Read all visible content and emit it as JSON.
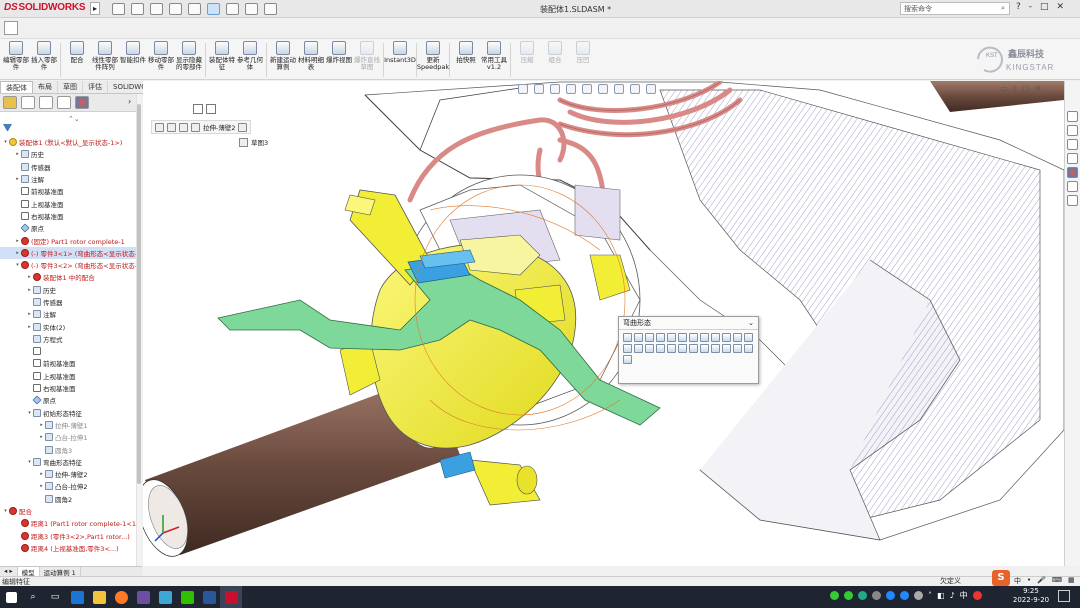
{
  "app": {
    "name": "SOLIDWORKS",
    "document_title": "装配体1.SLDASM *"
  },
  "titlebar": {
    "search_placeholder": "搜索命令",
    "controls": [
      "?",
      "-",
      "□",
      "✕"
    ]
  },
  "ribbon": {
    "buttons": [
      {
        "label": "编辑零部件",
        "icon": "edit-component-icon"
      },
      {
        "label": "插入零部件",
        "icon": "insert-component-icon"
      },
      {
        "label": "配合",
        "icon": "mate-icon"
      },
      {
        "label": "线性零部件阵列",
        "icon": "linear-pattern-icon"
      },
      {
        "label": "智能扣件",
        "icon": "smart-fasteners-icon"
      },
      {
        "label": "移动零部件",
        "icon": "move-component-icon"
      },
      {
        "label": "显示隐藏的零部件",
        "icon": "show-hidden-icon"
      },
      {
        "label": "装配体特征",
        "icon": "assembly-features-icon"
      },
      {
        "label": "参考几何体",
        "icon": "reference-geometry-icon"
      },
      {
        "label": "新建运动算例",
        "icon": "motion-study-icon"
      },
      {
        "label": "材料明细表",
        "icon": "bom-icon"
      },
      {
        "label": "爆炸视图",
        "icon": "exploded-view-icon"
      },
      {
        "label": "爆炸直线草图",
        "icon": "explode-line-icon",
        "disabled": true
      },
      {
        "label": "Instant3D",
        "icon": "instant3d-icon"
      },
      {
        "label": "更新Speedpak",
        "icon": "speedpak-icon"
      },
      {
        "label": "拍快照",
        "icon": "snapshot-icon"
      },
      {
        "label": "常用工具v1.2",
        "icon": "tools-icon"
      },
      {
        "label": "压缩",
        "icon": "suppress-icon",
        "disabled": true
      },
      {
        "label": "组合",
        "icon": "combine-icon",
        "disabled": true
      },
      {
        "label": "压凹",
        "icon": "indent-icon",
        "disabled": true
      }
    ],
    "brand": {
      "kst": "KST",
      "name_cn": "鑫辰科技",
      "name_en": "KINGSTAR"
    }
  },
  "command_tabs": [
    "装配体",
    "布局",
    "草图",
    "评估",
    "SOLIDWORKS 插件"
  ],
  "feature_tree": {
    "rows": [
      {
        "text": "装配体1 (默认<默认_显示状态-1>)",
        "level": 0,
        "icon": "assembly",
        "style": "red",
        "expand": "▾"
      },
      {
        "text": "历史",
        "level": 1,
        "icon": "folder",
        "expand": "▸"
      },
      {
        "text": "传感器",
        "level": 1,
        "icon": "folder",
        "expand": ""
      },
      {
        "text": "注解",
        "level": 1,
        "icon": "folder",
        "expand": "▸"
      },
      {
        "text": "前视基准面",
        "level": 1,
        "icon": "plane",
        "expand": ""
      },
      {
        "text": "上视基准面",
        "level": 1,
        "icon": "plane",
        "expand": ""
      },
      {
        "text": "右视基准面",
        "level": 1,
        "icon": "plane",
        "expand": ""
      },
      {
        "text": "原点",
        "level": 1,
        "icon": "point",
        "expand": ""
      },
      {
        "text": "(固定) Part1 rotor complete-1",
        "level": 1,
        "icon": "warning",
        "style": "red",
        "expand": "▸"
      },
      {
        "text": "(-) 零件3<1> (弯曲形态<显示状态-1>)",
        "level": 1,
        "icon": "warning",
        "style": "red",
        "expand": "▸",
        "highlight": true
      },
      {
        "text": "(-) 零件3<2> (弯曲形态<显示状态-1>)",
        "level": 1,
        "icon": "warning",
        "style": "red",
        "expand": "▾"
      },
      {
        "text": "装配体1 中的配合",
        "level": 2,
        "icon": "warning",
        "style": "red",
        "expand": "▸"
      },
      {
        "text": "历史",
        "level": 2,
        "icon": "folder",
        "expand": "▸"
      },
      {
        "text": "传感器",
        "level": 2,
        "icon": "folder",
        "expand": ""
      },
      {
        "text": "注解",
        "level": 2,
        "icon": "folder",
        "expand": "▸"
      },
      {
        "text": "实体(2)",
        "level": 2,
        "icon": "folder",
        "expand": "▸"
      },
      {
        "text": "方程式",
        "level": 2,
        "icon": "folder",
        "expand": ""
      },
      {
        "text": "",
        "level": 2,
        "icon": "plane",
        "expand": ""
      },
      {
        "text": "前视基准面",
        "level": 2,
        "icon": "plane",
        "expand": ""
      },
      {
        "text": "上视基准面",
        "level": 2,
        "icon": "plane",
        "expand": ""
      },
      {
        "text": "右视基准面",
        "level": 2,
        "icon": "plane",
        "expand": ""
      },
      {
        "text": "原点",
        "level": 2,
        "icon": "point",
        "expand": ""
      },
      {
        "text": "初始形态特征",
        "level": 2,
        "icon": "folder",
        "expand": "▾"
      },
      {
        "text": "拉伸-薄壁1",
        "level": 3,
        "icon": "feature",
        "style": "gray",
        "expand": "▸"
      },
      {
        "text": "凸台-拉伸1",
        "level": 3,
        "icon": "feature",
        "style": "gray",
        "expand": "▸"
      },
      {
        "text": "圆角3",
        "level": 3,
        "icon": "feature",
        "style": "gray",
        "expand": ""
      },
      {
        "text": "弯曲形态特征",
        "level": 2,
        "icon": "folder",
        "expand": "▾"
      },
      {
        "text": "拉伸-薄壁2",
        "level": 3,
        "icon": "feature",
        "expand": "▸"
      },
      {
        "text": "凸台-拉伸2",
        "level": 3,
        "icon": "feature",
        "expand": "▸"
      },
      {
        "text": "圆角2",
        "level": 3,
        "icon": "feature",
        "expand": ""
      },
      {
        "text": "配合",
        "level": 0,
        "icon": "warning",
        "style": "red",
        "expand": "▾"
      },
      {
        "text": "距离1 (Part1 rotor complete-1<1>...)",
        "level": 1,
        "icon": "warning",
        "style": "red",
        "expand": ""
      },
      {
        "text": "距离3 (零件3<2>,Part1 rotor...)",
        "level": 1,
        "icon": "warning",
        "style": "red",
        "expand": ""
      },
      {
        "text": "距离4 (上视基准面,零件3<...)",
        "level": 1,
        "icon": "warning",
        "style": "red",
        "expand": ""
      }
    ]
  },
  "bottom_tabs": [
    "模型",
    "运动算例 1"
  ],
  "viewport": {
    "breadcrumb": [
      "拉伸-薄壁2"
    ],
    "breadcrumb2": "草图3",
    "popup": {
      "title": "弯曲形态"
    }
  },
  "status": {
    "left": "编辑特征",
    "right": "欠定义"
  },
  "taskbar": {
    "ime": "中",
    "lang": "中",
    "time": "9:25",
    "date": "2022-9-20"
  },
  "colors": {
    "yellow_part": "#f2ee35",
    "green_part": "#7dd89a",
    "shaft": "#7c5a4c",
    "coil": "#d98a86",
    "selection": "#cfe0f7",
    "warning_red": "#c01818"
  }
}
